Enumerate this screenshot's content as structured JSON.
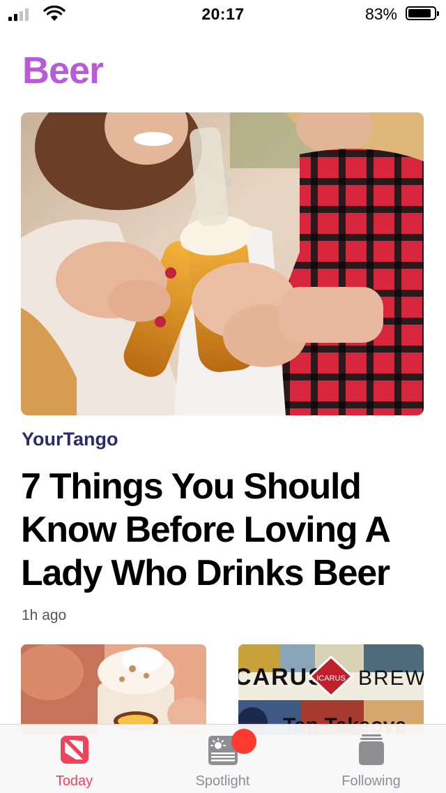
{
  "status_bar": {
    "time": "20:17",
    "battery_percent": "83%",
    "battery_level": 0.83,
    "signal_bars_filled": 2,
    "signal_bars_total": 4
  },
  "page": {
    "title": "Beer",
    "title_color": "#b85bd8"
  },
  "hero_article": {
    "source": "YourTango",
    "headline": "7 Things You Should Know Before Loving A Lady Who Drinks Beer",
    "age": "1h ago",
    "image": "two-women-clinking-beer-bottles"
  },
  "cards": [
    {
      "image": "aw-root-beer-float"
    },
    {
      "image": "icarus-brewing-tap-takeover",
      "logo_text": "ICARUS"
    }
  ],
  "tabbar": {
    "accent_color": "#f0445c",
    "inactive_color": "#8e8e93",
    "tabs": [
      {
        "label": "Today",
        "icon": "news-icon",
        "active": true
      },
      {
        "label": "Spotlight",
        "icon": "spotlight-icon",
        "active": false,
        "badge": true
      },
      {
        "label": "Following",
        "icon": "following-icon",
        "active": false
      }
    ]
  }
}
